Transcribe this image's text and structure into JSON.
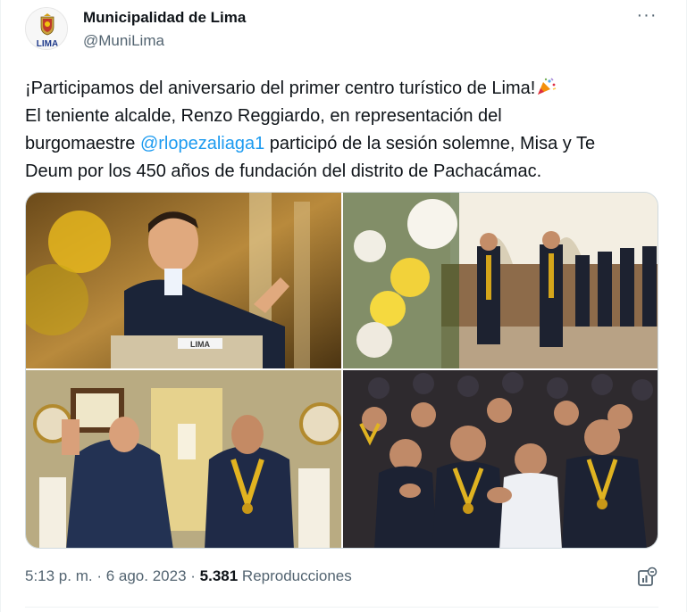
{
  "account": {
    "name": "Municipalidad de Lima",
    "handle": "@MuniLima",
    "avatar_text": "LIMA"
  },
  "menu": {
    "more_icon": "more-horizontal-icon",
    "more_label": "···"
  },
  "tweet": {
    "line1": "¡Participamos del aniversario del primer centro turístico de Lima!",
    "line1_emoji": "party-popper-icon",
    "line2": "El teniente alcalde, Renzo Reggiardo, en representación del",
    "line3_pre": "burgomaestre ",
    "mention": "@rlopezaliaga1",
    "line3_post": " participó de la sesión solemne, Misa y Te",
    "line4": "Deum por los 450 años de fundación del distrito de Pachacámac.",
    "photo_labels": {
      "podium": "LIMA"
    }
  },
  "meta": {
    "time": "5:13 p. m.",
    "separator1": " · ",
    "date": "6 ago. 2023",
    "separator2": " · ",
    "views_count": "5.381",
    "views_label": " Reproducciones"
  },
  "icons": {
    "analytics": "analytics-icon"
  },
  "colors": {
    "link": "#1d9bf0",
    "secondary_text": "#536471",
    "primary_text": "#0f1419",
    "border": "#cfd9de"
  }
}
